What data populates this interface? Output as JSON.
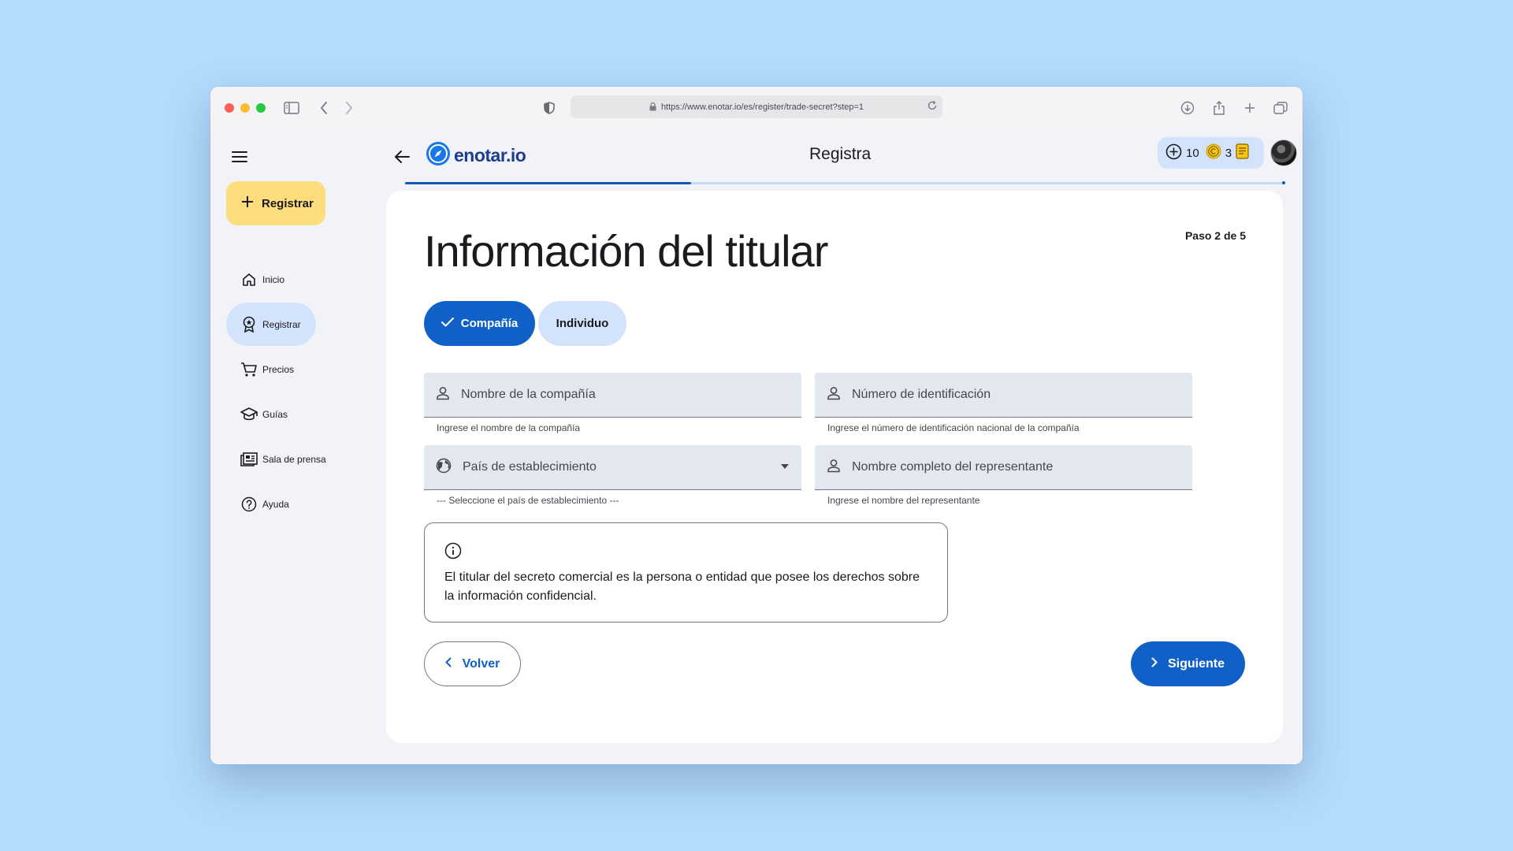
{
  "browser": {
    "url": "https://www.enotar.io/es/register/trade-secret?step=1"
  },
  "sidebar": {
    "fab_label": "Registrar",
    "items": [
      {
        "label": "Inicio",
        "icon": "home-icon"
      },
      {
        "label": "Registrar",
        "icon": "award-icon",
        "active": true
      },
      {
        "label": "Precios",
        "icon": "cart-icon"
      },
      {
        "label": "Guías",
        "icon": "graduation-cap-icon"
      },
      {
        "label": "Sala de prensa",
        "icon": "newspaper-icon"
      },
      {
        "label": "Ayuda",
        "icon": "help-circle-icon"
      }
    ]
  },
  "header": {
    "logo_text": "enotar.io",
    "title": "Registra",
    "credits_value": "10",
    "coins_value": "3"
  },
  "progress": {
    "fraction": 0.325
  },
  "form": {
    "step_label": "Paso 2 de 5",
    "title": "Información del titular",
    "toggle": {
      "selected": "Compañía",
      "unselected": "Individuo"
    },
    "fields": [
      {
        "label": "Nombre de la compañía",
        "help": "Ingrese el nombre de la compañía",
        "icon": "person-icon"
      },
      {
        "label": "Número de identificación",
        "help": "Ingrese el número de identificación nacional de la compañía",
        "icon": "person-icon"
      },
      {
        "label": "País de establecimiento",
        "help": "--- Seleccione el país de establecimiento ---",
        "icon": "globe-icon",
        "dropdown": true
      },
      {
        "label": "Nombre completo del representante",
        "help": "Ingrese el nombre del representante",
        "icon": "person-icon"
      }
    ],
    "info_text": "El titular del secreto comercial es la persona o entidad que posee los derechos sobre la información confidencial.",
    "back_label": "Volver",
    "next_label": "Siguiente"
  },
  "colors": {
    "primary": "#1060c7",
    "fab": "#fddd7c",
    "active_nav": "#d3e3fb",
    "background": "#b3dbfd"
  }
}
